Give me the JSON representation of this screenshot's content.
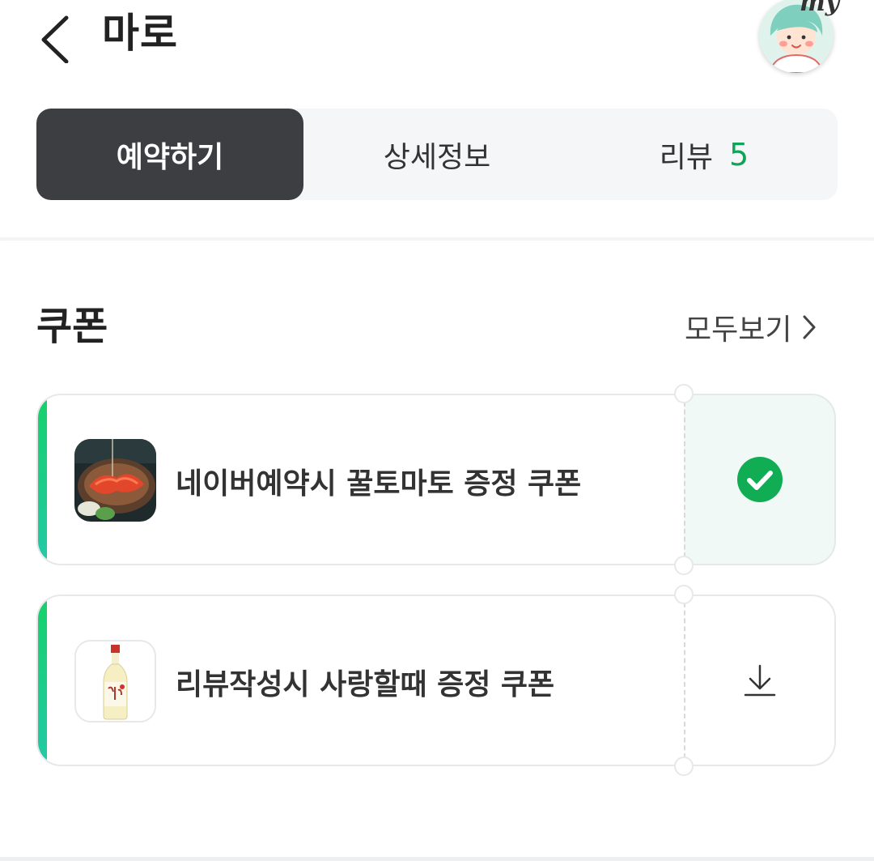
{
  "header": {
    "title": "마로",
    "back_icon": "chevron-left-icon",
    "avatar_icon": "my-avatar-icon",
    "avatar_badge": "my"
  },
  "tabs": [
    {
      "label": "예약하기",
      "active": true
    },
    {
      "label": "상세정보",
      "active": false
    },
    {
      "label": "리뷰",
      "count": "5",
      "active": false
    }
  ],
  "coupons_section": {
    "title": "쿠폰",
    "view_all_label": "모두보기",
    "view_all_icon": "chevron-right-icon"
  },
  "coupons": [
    {
      "title": "네이버예약시 꿀토마토 증정 쿠폰",
      "thumbnail": "tomato-dish-image",
      "status": "claimed",
      "status_icon": "check-circle-icon"
    },
    {
      "title": "리뷰작성시 사랑할때 증정 쿠폰",
      "thumbnail": "soju-bottle-image",
      "status": "available",
      "status_icon": "download-icon"
    }
  ],
  "colors": {
    "accent_green": "#11a35a",
    "active_tab_bg": "#3d3e42",
    "tab_bar_bg": "#f5f6f8",
    "coupon_accent_start": "#17d16b",
    "coupon_accent_end": "#22c9a8",
    "claimed_bg": "#f0f9f5"
  }
}
